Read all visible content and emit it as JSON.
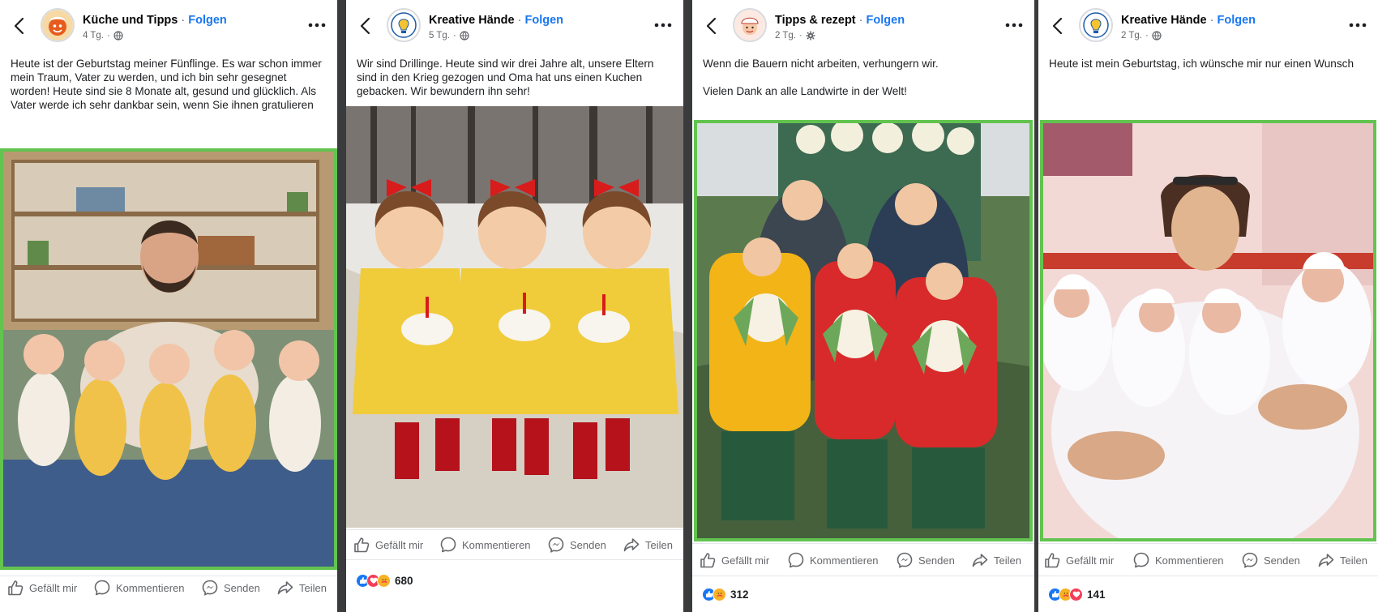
{
  "posts": [
    {
      "page_name": "Küche und Tipps",
      "follow": "Folgen",
      "time": "4 Tg.",
      "text": [
        "Heute ist der Geburtstag meiner Fünflinge. Es war schon immer mein Traum, Vater zu werden, und ich bin sehr gesegnet worden! Heute sind sie 8 Monate alt, gesund und glücklich. Als Vater werde ich sehr dankbar sein, wenn Sie ihnen gratulieren"
      ],
      "actions": {
        "like": "Gefällt mir",
        "comment": "Kommentieren",
        "send": "Senden",
        "share": "Teilen"
      }
    },
    {
      "page_name": "Kreative Hände",
      "follow": "Folgen",
      "time": "5 Tg.",
      "text": [
        "Wir sind Drillinge. Heute sind wir drei Jahre alt, unsere Eltern sind in den Krieg gezogen und Oma hat uns einen Kuchen gebacken. Wir bewundern ihn sehr!"
      ],
      "actions": {
        "like": "Gefällt mir",
        "comment": "Kommentieren",
        "send": "Senden",
        "share": "Teilen"
      },
      "reactions_count": "680"
    },
    {
      "page_name": "Tipps & rezept",
      "follow": "Folgen",
      "time": "2 Tg.",
      "text": [
        "Wenn die Bauern nicht arbeiten, verhungern wir.",
        "Vielen Dank an alle Landwirte in der Welt!"
      ],
      "actions": {
        "like": "Gefällt mir",
        "comment": "Kommentieren",
        "send": "Senden",
        "share": "Teilen"
      },
      "reactions_count": "312"
    },
    {
      "page_name": "Kreative Hände",
      "follow": "Folgen",
      "time": "2 Tg.",
      "text": [
        "Heute ist mein Geburtstag, ich wünsche mir nur einen Wunsch"
      ],
      "actions": {
        "like": "Gefällt mir",
        "comment": "Kommentieren",
        "send": "Senden",
        "share": "Teilen"
      },
      "reactions_count": "141"
    }
  ],
  "colors": {
    "highlight_border": "#62c44f",
    "follow_link": "#1877f2",
    "like_blue": "#1877f2",
    "love_red": "#f33e58",
    "care_yellow": "#f7b125"
  },
  "icons": [
    "chevron-left-icon",
    "more-dots-icon",
    "globe-icon",
    "gear-icon",
    "like-icon",
    "comment-icon",
    "messenger-icon",
    "share-icon"
  ]
}
